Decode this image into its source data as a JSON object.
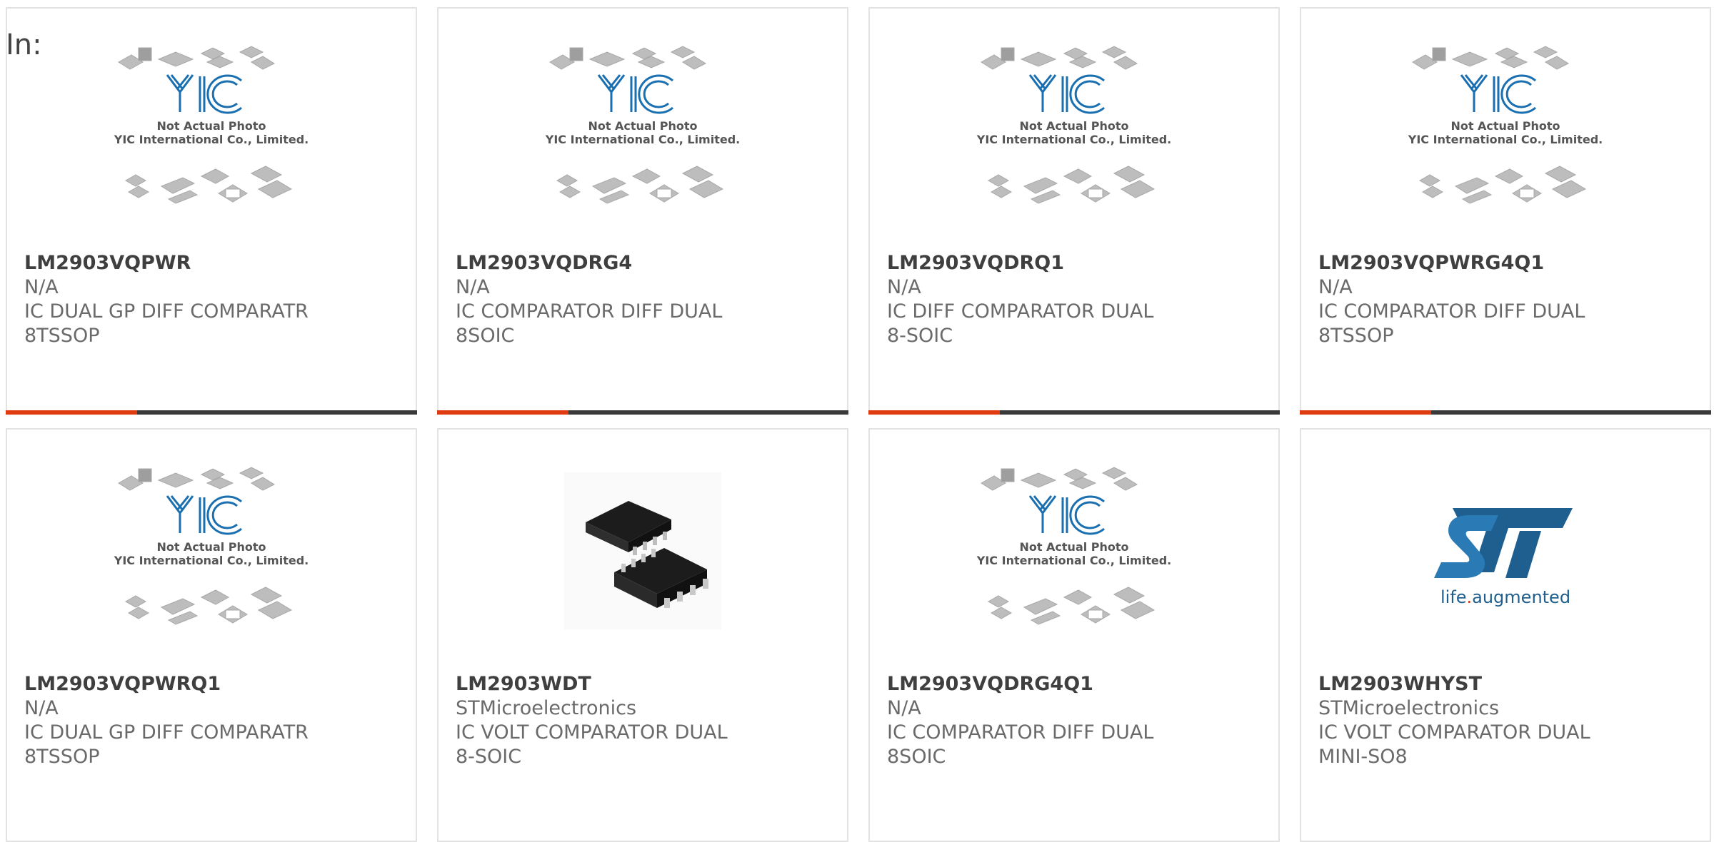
{
  "heading": "In:",
  "placeholder": {
    "line1": "Not Actual Photo",
    "line2": "YIC International Co., Limited.",
    "logo_text": "YIC"
  },
  "st_logo": {
    "tagline_part1": "life",
    "tagline_dot": ".",
    "tagline_part2": "augmented"
  },
  "colors": {
    "accent": "#e03a10",
    "bar": "#3a3a3a",
    "yic_blue": "#1a6fb0",
    "st_blue": "#1f5f8f"
  },
  "products": [
    {
      "part": "LM2903VQPWR",
      "mfr": "N/A",
      "desc": "IC DUAL GP DIFF COMPARATR 8TSSOP",
      "image": "placeholder"
    },
    {
      "part": "LM2903VQDRG4",
      "mfr": "N/A",
      "desc": "IC COMPARATOR DIFF DUAL 8SOIC",
      "image": "placeholder"
    },
    {
      "part": "LM2903VQDRQ1",
      "mfr": "N/A",
      "desc": "IC DIFF COMPARATOR DUAL 8-SOIC",
      "image": "placeholder"
    },
    {
      "part": "LM2903VQPWRG4Q1",
      "mfr": "N/A",
      "desc": "IC COMPARATOR DIFF DUAL 8TSSOP",
      "image": "placeholder"
    },
    {
      "part": "LM2903VQPWRQ1",
      "mfr": "N/A",
      "desc": "IC DUAL GP DIFF COMPARATR 8TSSOP",
      "image": "placeholder"
    },
    {
      "part": "LM2903WDT",
      "mfr": "STMicroelectronics",
      "desc": "IC VOLT COMPARATOR DUAL 8-SOIC",
      "image": "soic-chip"
    },
    {
      "part": "LM2903VQDRG4Q1",
      "mfr": "N/A",
      "desc": "IC COMPARATOR DIFF DUAL 8SOIC",
      "image": "placeholder"
    },
    {
      "part": "LM2903WHYST",
      "mfr": "STMicroelectronics",
      "desc": "IC VOLT COMPARATOR DUAL MINI-SO8",
      "image": "st-logo"
    }
  ]
}
